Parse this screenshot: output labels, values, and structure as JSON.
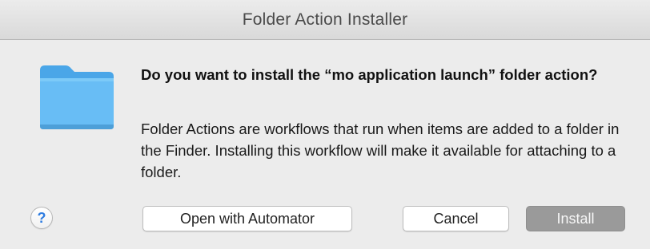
{
  "window": {
    "title": "Folder Action Installer"
  },
  "dialog": {
    "icon": "folder-icon",
    "heading": "Do you want to install the “mo application launch” folder action?",
    "body": "Folder Actions are workflows that run when items are added to a folder in the Finder. Installing this workflow will make it available for attaching to a folder."
  },
  "buttons": {
    "help_label": "?",
    "open_with_automator_label": "Open with Automator",
    "cancel_label": "Cancel",
    "install_label": "Install",
    "install_state": "disabled"
  },
  "colors": {
    "window_background": "#ececec",
    "folder_blue": "#5fb8f3",
    "help_blue": "#2f7de1",
    "install_disabled": "#9a9a9a"
  }
}
